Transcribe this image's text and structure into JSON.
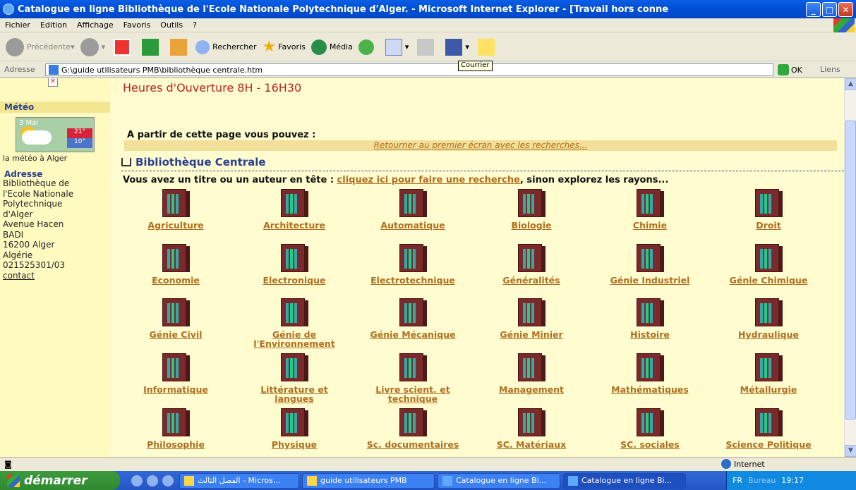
{
  "window": {
    "title": "Catalogue en ligne Bibliothèque de l'Ecole Nationale Polytechnique d'Alger. - Microsoft Internet Explorer - [Travail hors conne"
  },
  "menu": [
    "Fichier",
    "Edition",
    "Affichage",
    "Favoris",
    "Outils",
    "?"
  ],
  "toolbar": {
    "back": "Précédente",
    "search": "Rechercher",
    "favorites": "Favoris",
    "media": "Média"
  },
  "tooltip": "Courrier",
  "address": {
    "label": "Adresse",
    "value": "G:\\guide utilisateurs PMB\\bibliothèque centrale.htm",
    "go": "OK",
    "links": "Liens"
  },
  "sidebar": {
    "meteo_title": "Météo",
    "date": "3 Mai",
    "temp_high": "21°",
    "temp_low": "10°",
    "meteo_link": "la météo à Alger",
    "adresse_title": "Adresse",
    "address_lines": [
      "Bibliothèque de",
      "l'Ecole Nationale",
      "Polytechnique",
      "d'Alger",
      "Avenue Hacen",
      "BADI",
      "16200 Alger",
      "Algérie",
      "021525301/03"
    ],
    "contact": "contact"
  },
  "main": {
    "hours": "Heures d'Ouverture 8H - 16H30",
    "partir": "A partir de cette page vous pouvez :",
    "retour": "Retourner au premier écran avec les recherches...",
    "breadcrumb": "Bibliothèque Centrale",
    "vous_prefix": "Vous avez un titre ou un auteur en tête : ",
    "vous_link": "cliquez ici pour faire une recherche",
    "vous_suffix": ", sinon explorez les rayons..."
  },
  "rayons": [
    [
      "Agriculture",
      "Architecture",
      "Automatique",
      "Biologie",
      "Chimie",
      "Droit"
    ],
    [
      "Economie",
      "Electronique",
      "Electrotechnique",
      "Généralités",
      "Génie Industriel",
      "Génie Chimique"
    ],
    [
      "Génie Civil",
      "Génie de l'Environnement",
      "Génie Mécanique",
      "Génie Minier",
      "Histoire",
      "Hydraulique"
    ],
    [
      "Informatique",
      "Littérature et langues",
      "Livre scient. et technique",
      "Management",
      "Mathématiques",
      "Métallurgie"
    ],
    [
      "Philosophie",
      "Physique",
      "Sc. documentaires",
      "SC. Matériaux",
      "SC. sociales",
      "Science Politique"
    ]
  ],
  "status": {
    "zone": "Internet"
  },
  "taskbar": {
    "start": "démarrer",
    "tasks": [
      "الفصل الثالث - Micros...",
      "guide utilisateurs PMB",
      "Catalogue en ligne Bi...",
      "Catalogue en ligne Bi..."
    ],
    "lang": "FR",
    "desk": "Bureau",
    "time": "19:17"
  }
}
